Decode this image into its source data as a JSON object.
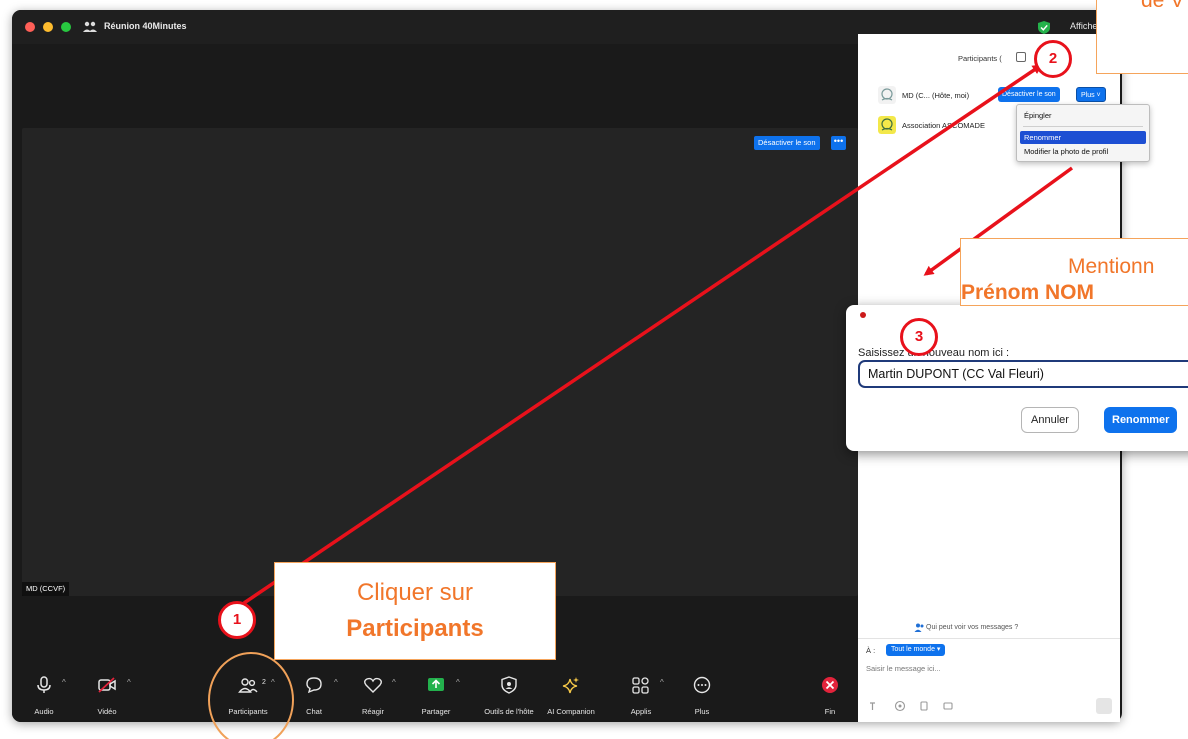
{
  "window": {
    "title": "Réunion 40Minutes",
    "top_right_label": "Affiche"
  },
  "video": {
    "mute_button": "Désactiver le son",
    "more_button": "•••",
    "name_tag": "MD (CCVF)"
  },
  "toolbar": {
    "items": [
      {
        "label": "Audio",
        "icon": "microphone-icon"
      },
      {
        "label": "Vidéo",
        "icon": "video-off-icon"
      },
      {
        "label": "Participants",
        "icon": "participants-icon",
        "count": "2"
      },
      {
        "label": "Chat",
        "icon": "chat-icon"
      },
      {
        "label": "Réagir",
        "icon": "heart-icon"
      },
      {
        "label": "Partager",
        "icon": "share-screen-icon"
      },
      {
        "label": "Outils de l'hôte",
        "icon": "shield-icon"
      },
      {
        "label": "AI Companion",
        "icon": "sparkle-icon"
      },
      {
        "label": "Applis",
        "icon": "apps-icon"
      },
      {
        "label": "Plus",
        "icon": "more-icon"
      },
      {
        "label": "Fin",
        "icon": "end-call-icon"
      }
    ],
    "caret": "^"
  },
  "participants_panel": {
    "title": "Participants (",
    "rows": [
      {
        "name": "MD (C...  (Hôte, moi)",
        "mute_button": "Désactiver le son",
        "more_button": "Plus ˅"
      },
      {
        "name": "Association ASCOMADE"
      }
    ],
    "who_can_see": "Qui peut voir vos messages ?",
    "to_label": "À :",
    "to_value": "Tout le monde ▾",
    "message_placeholder": "Saisir le message ici..."
  },
  "context_menu": {
    "items": [
      "Épingler",
      "Renommer",
      "Modifier la photo de profil"
    ],
    "highlighted": "Renommer"
  },
  "rename_dialog": {
    "label": "Saisissez un nouveau nom ici :",
    "value": "Martin DUPONT (CC Val Fleuri)",
    "cancel_button": "Annuler",
    "confirm_button": "Renommer"
  },
  "annotations": {
    "callout_1": {
      "line1": "Cliquer sur",
      "line2": "Participants"
    },
    "callout_2": {
      "line1": "de V"
    },
    "callout_3": {
      "line1": "Mentionn",
      "line2": "Prénom NOM"
    },
    "badges": [
      "1",
      "2",
      "3"
    ]
  },
  "colors": {
    "zoom_blue": "#0e72ed",
    "annotation_red": "#e8111b",
    "annotation_orange": "#f1762a",
    "menu_highlight": "#1d4fd3"
  }
}
